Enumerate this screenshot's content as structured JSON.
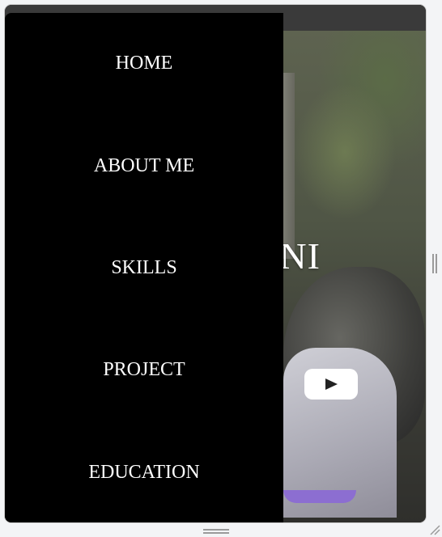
{
  "hero": {
    "title_visible": "LINI",
    "play_icon": "youtube-play-icon"
  },
  "menu": {
    "items": [
      {
        "label": "HOME"
      },
      {
        "label": "ABOUT ME"
      },
      {
        "label": "SKILLS"
      },
      {
        "label": "PROJECT"
      },
      {
        "label": "EDUCATION"
      }
    ]
  },
  "colors": {
    "menu_bg": "#000000",
    "menu_text": "#ffffff",
    "trim_accent": "#8c6ed1",
    "play_bg": "#ffffff"
  }
}
